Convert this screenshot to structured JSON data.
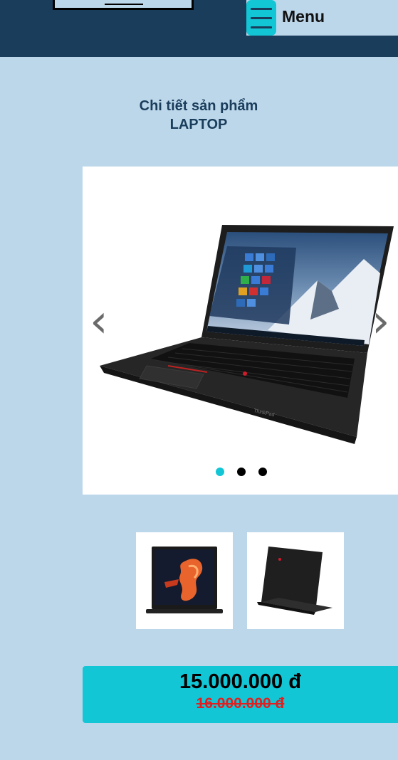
{
  "header": {
    "menu_label": "Menu",
    "colors": {
      "background": "#1a3d5c",
      "menu_button": "#13c6d6"
    },
    "icons": {
      "menu": "hamburger-icon"
    }
  },
  "page": {
    "title": "Chi tiết sản phẩm",
    "product_name": "LAPTOP"
  },
  "carousel": {
    "images": [
      "laptop-front",
      "laptop-open",
      "laptop-back"
    ],
    "active_index": 0,
    "prev_icon": "chevron-left-icon",
    "next_icon": "chevron-right-icon",
    "dot_colors": {
      "active": "#13c6d6",
      "inactive": "#000000"
    }
  },
  "thumbnails": [
    "laptop-front-thumbnail",
    "laptop-back-thumbnail"
  ],
  "price": {
    "current": "15.000.000 đ",
    "original": "16.000.000 đ",
    "colors": {
      "box": "#13c6d6",
      "original": "#e02020"
    }
  }
}
